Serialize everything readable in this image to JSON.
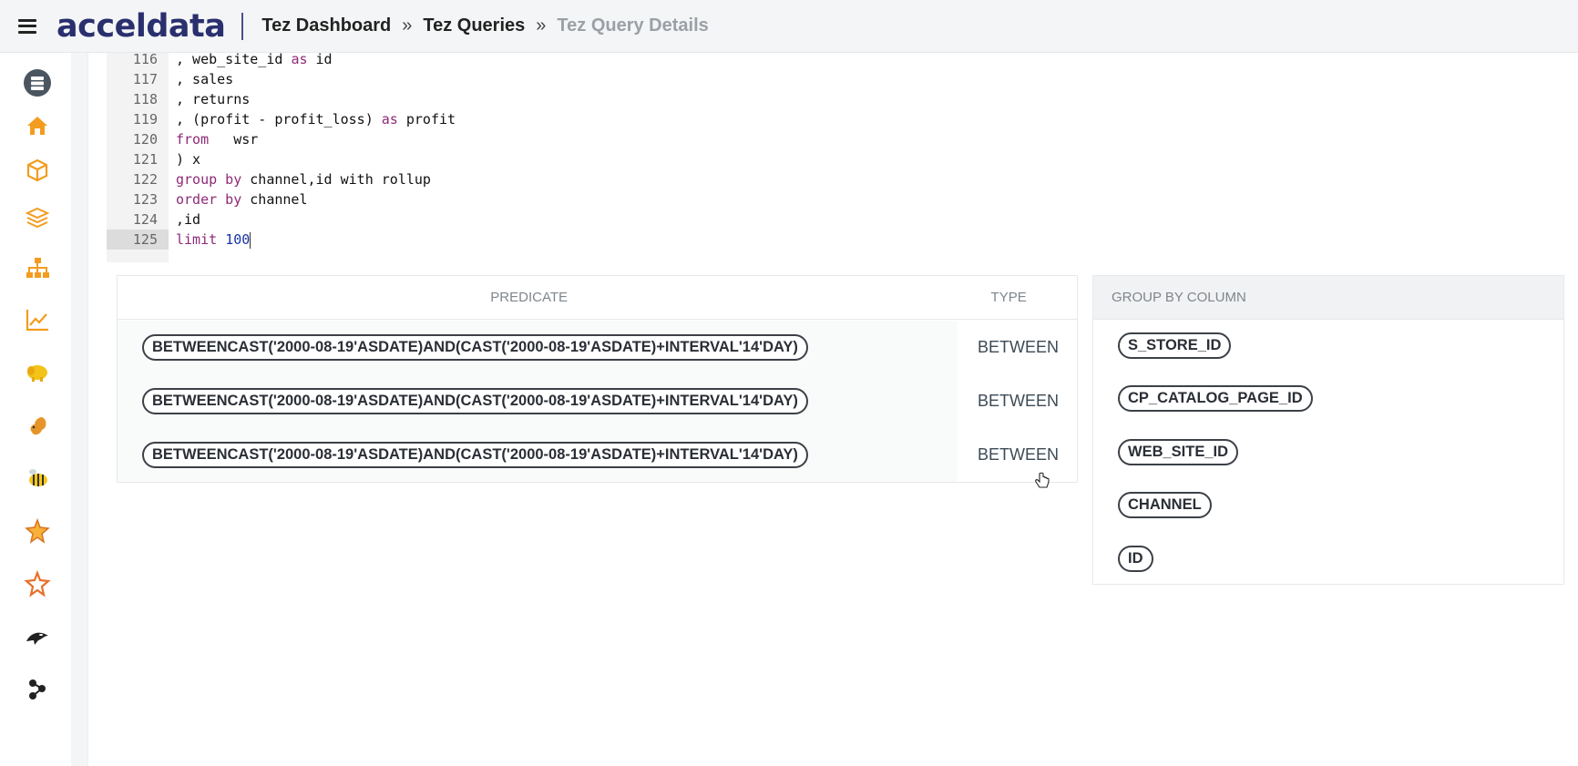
{
  "header": {
    "logo": "acceldata",
    "breadcrumbs": [
      "Tez Dashboard",
      "Tez Queries",
      "Tez Query Details"
    ],
    "breadcrumb_separator": "»"
  },
  "sidebar": {
    "icons": [
      "database-icon",
      "home-icon",
      "cube-icon",
      "layers-icon",
      "hierarchy-icon",
      "chart-line-icon",
      "hadoop-elephant-icon",
      "squirrel-icon",
      "hive-bee-icon",
      "pig-star-icon",
      "star-icon",
      "orca-whale-icon",
      "molecule-icon"
    ],
    "accent_color": "#f39c1f"
  },
  "editor": {
    "lines": [
      {
        "n": "116",
        "tokens": [
          {
            "t": ", web_site_id ",
            "c": ""
          },
          {
            "t": "as",
            "c": "kw"
          },
          {
            "t": " id",
            "c": ""
          }
        ]
      },
      {
        "n": "117",
        "tokens": [
          {
            "t": ", sales",
            "c": ""
          }
        ]
      },
      {
        "n": "118",
        "tokens": [
          {
            "t": ", returns",
            "c": ""
          }
        ]
      },
      {
        "n": "119",
        "tokens": [
          {
            "t": ", (profit - profit_loss) ",
            "c": ""
          },
          {
            "t": "as",
            "c": "kw"
          },
          {
            "t": " profit",
            "c": ""
          }
        ]
      },
      {
        "n": "120",
        "tokens": [
          {
            "t": "from",
            "c": "kw"
          },
          {
            "t": "   wsr",
            "c": ""
          }
        ]
      },
      {
        "n": "121",
        "tokens": [
          {
            "t": ") x",
            "c": ""
          }
        ]
      },
      {
        "n": "122",
        "tokens": [
          {
            "t": "group by",
            "c": "kw"
          },
          {
            "t": " channel,id with rollup",
            "c": ""
          }
        ]
      },
      {
        "n": "123",
        "tokens": [
          {
            "t": "order by",
            "c": "kw"
          },
          {
            "t": " channel",
            "c": ""
          }
        ]
      },
      {
        "n": "124",
        "tokens": [
          {
            "t": ",id",
            "c": ""
          }
        ]
      },
      {
        "n": "125",
        "tokens": [
          {
            "t": "limit",
            "c": "kw"
          },
          {
            "t": " ",
            "c": ""
          },
          {
            "t": "100",
            "c": "num"
          }
        ]
      }
    ]
  },
  "predicates": {
    "headers": {
      "predicate": "PREDICATE",
      "type": "TYPE"
    },
    "rows": [
      {
        "predicate": "BETWEENCAST('2000-08-19'ASDATE)AND(CAST('2000-08-19'ASDATE)+INTERVAL'14'DAY)",
        "type": "BETWEEN"
      },
      {
        "predicate": "BETWEENCAST('2000-08-19'ASDATE)AND(CAST('2000-08-19'ASDATE)+INTERVAL'14'DAY)",
        "type": "BETWEEN"
      },
      {
        "predicate": "BETWEENCAST('2000-08-19'ASDATE)AND(CAST('2000-08-19'ASDATE)+INTERVAL'14'DAY)",
        "type": "BETWEEN"
      }
    ]
  },
  "group_by": {
    "header": "GROUP BY COLUMN",
    "columns": [
      "S_STORE_ID",
      "CP_CATALOG_PAGE_ID",
      "WEB_SITE_ID",
      "CHANNEL",
      "ID"
    ]
  }
}
